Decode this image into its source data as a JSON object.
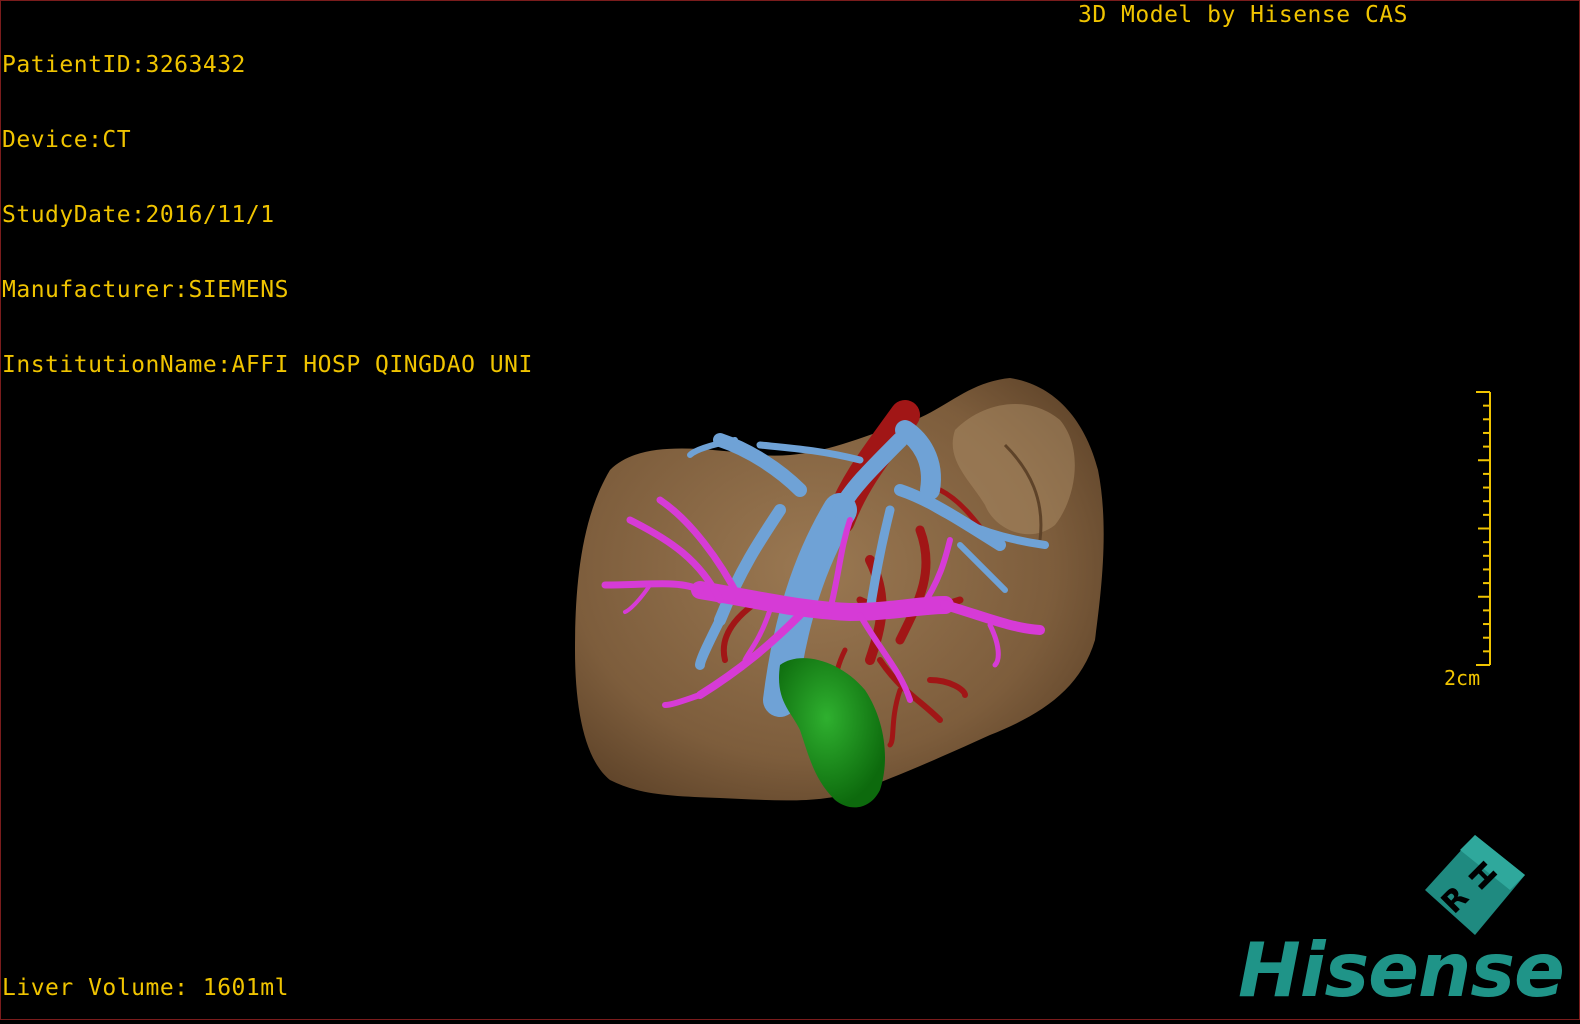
{
  "info": {
    "patient_id": "PatientID:3263432",
    "device": "Device:CT",
    "study_date": "StudyDate:2016/11/1",
    "manufacturer": "Manufacturer:SIEMENS",
    "institution": "InstitutionName:AFFI HOSP QINGDAO UNI"
  },
  "brand_label": "3D Model by Hisense CAS",
  "liver_volume": "Liver Volume: 1601ml",
  "scale_bar": {
    "label": "2cm"
  },
  "orientation_cube": {
    "faces": [
      "H",
      "R"
    ]
  },
  "logo_text": "Hisense",
  "colors": {
    "overlay_text": "#f0c400",
    "liver": "#8b6a47",
    "hepatic_vein": "#6fa2d6",
    "portal_vein": "#d63bd6",
    "hepatic_artery": "#a11616",
    "gallbladder": "#1a8f1a",
    "logo": "#1f9488"
  },
  "model_structures": [
    "liver",
    "hepatic-vein",
    "portal-vein",
    "hepatic-artery",
    "gallbladder"
  ]
}
